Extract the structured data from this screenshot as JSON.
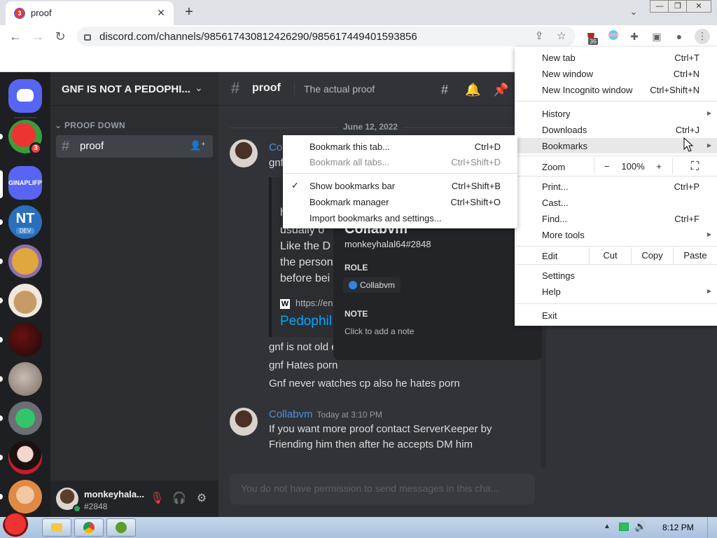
{
  "browser": {
    "tab_title": "proof",
    "tab_badge": "3",
    "url": "discord.com/channels/985617430812426290/985617449401593856",
    "ext_badge": "36",
    "window_min": "—",
    "window_max": "❐",
    "window_close": "✕"
  },
  "discord": {
    "server_name": "GNF IS NOT A PEDOPHI...",
    "category": "PROOF DOWN",
    "channel": "proof",
    "topic": "The actual proof",
    "date_divider": "June 12, 2022",
    "guild_badge": "3",
    "guild_label": "GINAPLIFP",
    "guild_nt": "NT",
    "guild_dev": "DEV",
    "user": {
      "name": "monkeyhala...",
      "tag": "#2848"
    },
    "messages": {
      "m1_author": "Co",
      "m1_line1": "gnf",
      "embed_lines": [
        "usually o",
        "Like the D",
        "the person",
        "before bei"
      ],
      "embed_h": "h",
      "embed_link": "https://en.",
      "embed_title": "Pedophil",
      "line_a": "gnf is not old e",
      "line_b": "gnf Hates porn",
      "line_c": "Gnf never watches cp also he hates porn",
      "m2_author": "Collabvm",
      "m2_time": "Today at 3:10 PM",
      "m2_line1": "If you want more proof contact ServerKeeper by",
      "m2_line2": "Friending him then after he accepts DM him"
    },
    "input_placeholder": "You do not have permission to send messages in this cha...",
    "popout": {
      "name": "Collabvm",
      "tag": "monkeyhalal64#2848",
      "role_label": "ROLE",
      "role": "Collabvm",
      "note_label": "NOTE",
      "note_placeholder": "Click to add a note"
    }
  },
  "menu": {
    "new_tab": "New tab",
    "new_tab_k": "Ctrl+T",
    "new_window": "New window",
    "new_window_k": "Ctrl+N",
    "incognito": "New Incognito window",
    "incognito_k": "Ctrl+Shift+N",
    "history": "History",
    "downloads": "Downloads",
    "downloads_k": "Ctrl+J",
    "bookmarks": "Bookmarks",
    "zoom": "Zoom",
    "zoom_minus": "−",
    "zoom_value": "100%",
    "zoom_plus": "+",
    "print": "Print...",
    "print_k": "Ctrl+P",
    "cast": "Cast...",
    "find": "Find...",
    "find_k": "Ctrl+F",
    "more_tools": "More tools",
    "edit": "Edit",
    "cut": "Cut",
    "copy": "Copy",
    "paste": "Paste",
    "settings": "Settings",
    "help": "Help",
    "exit": "Exit"
  },
  "submenu": {
    "bookmark_tab": "Bookmark this tab...",
    "bookmark_tab_k": "Ctrl+D",
    "bookmark_all": "Bookmark all tabs...",
    "bookmark_all_k": "Ctrl+Shift+D",
    "show_bar": "Show bookmarks bar",
    "show_bar_k": "Ctrl+Shift+B",
    "manager": "Bookmark manager",
    "manager_k": "Ctrl+Shift+O",
    "import": "Import bookmarks and settings..."
  },
  "taskbar": {
    "clock": "8:12 PM"
  }
}
